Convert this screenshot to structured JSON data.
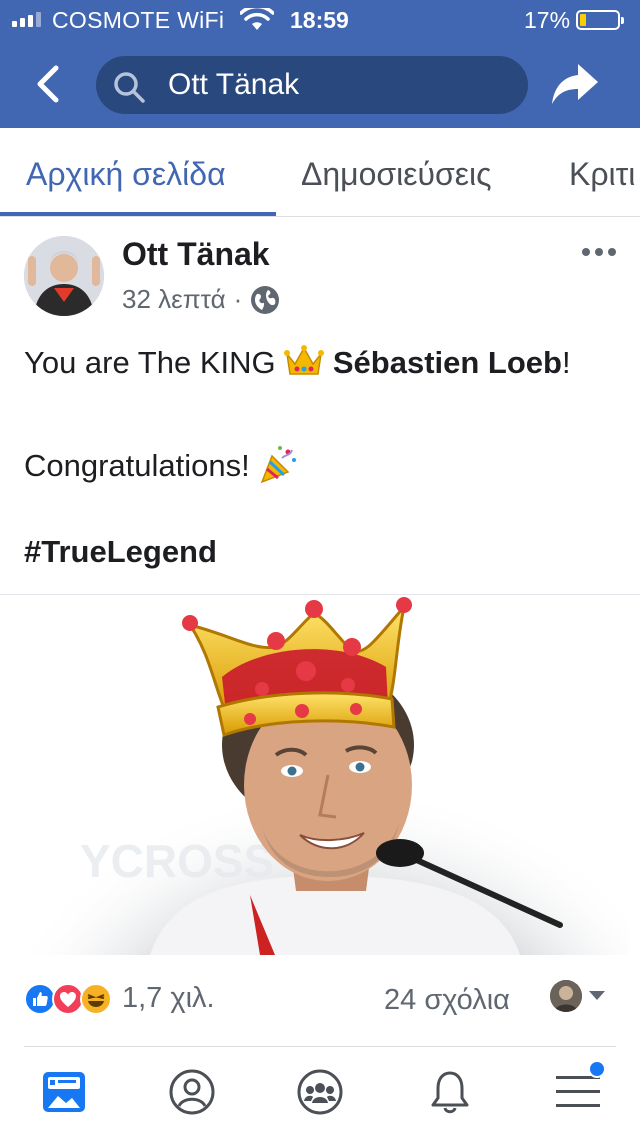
{
  "status_bar": {
    "carrier": "COSMOTE WiFi",
    "time": "18:59",
    "battery": "17%",
    "battery_level": 0.17
  },
  "header": {
    "search_value": "Ott Tänak",
    "icons": [
      "back-arrow-icon",
      "search-icon",
      "share-icon"
    ]
  },
  "tabs": [
    {
      "label": "Αρχική σελίδα",
      "active": true
    },
    {
      "label": "Δημοσιεύσεις",
      "active": false
    },
    {
      "label": "Κριτι",
      "active": false
    }
  ],
  "post": {
    "author": "Ott Tänak",
    "time_ago": "32 λεπτά",
    "separator": "·",
    "line1_prefix": "You are The KING",
    "line1_name": "Sébastien Loeb",
    "line1_suffix": "!",
    "line2": "Congratulations!",
    "hashtag": "#TrueLegend"
  },
  "reactions": {
    "count": "1,7 χιλ.",
    "comments": "24 σχόλια",
    "types": [
      "like",
      "love",
      "haha"
    ]
  },
  "bottom_nav": [
    {
      "name": "news-feed",
      "active": true
    },
    {
      "name": "profile",
      "active": false
    },
    {
      "name": "groups",
      "active": false
    },
    {
      "name": "notifications",
      "active": false
    },
    {
      "name": "menu",
      "active": false,
      "has_badge": true
    }
  ],
  "colors": {
    "brand": "#4267b2",
    "brand_dark": "#29487d",
    "text": "#1c1e21",
    "secondary": "#606770"
  }
}
